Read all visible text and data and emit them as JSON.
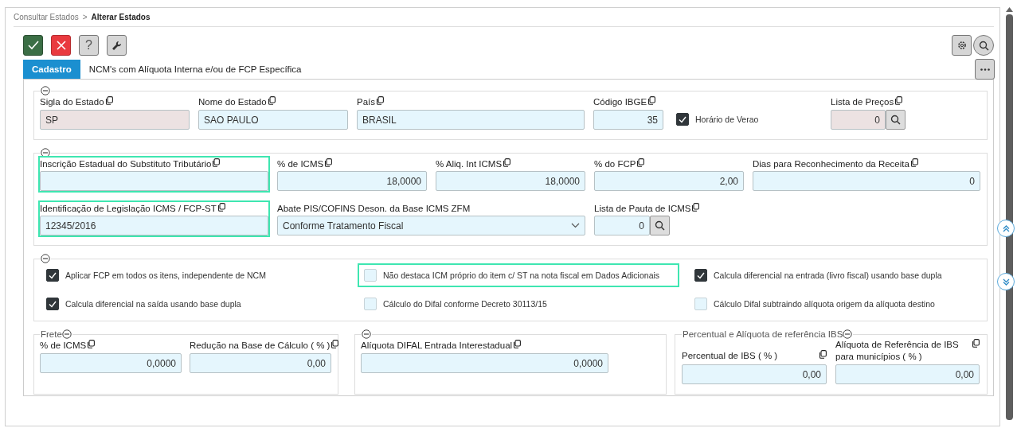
{
  "breadcrumb": [
    {
      "label": "Consultar Estados",
      "current": false
    },
    {
      "label": "Alterar Estados",
      "current": true
    }
  ],
  "breadcrumb_separator": ">",
  "toolbar": [
    {
      "kind": "confirm"
    },
    {
      "kind": "cancel"
    },
    {
      "kind": "help",
      "label": "?"
    },
    {
      "kind": "tools"
    }
  ],
  "right_toolbar": [
    {
      "kind": "settings"
    },
    {
      "kind": "search"
    }
  ],
  "tabs": [
    {
      "label": "Cadastro",
      "selected": true
    },
    {
      "label": "NCM's com Alíquota Interna e/ou de FCP Específica",
      "selected": false
    }
  ],
  "general": {
    "items": [
      {
        "kind": "text",
        "label": "Sigla do Estado",
        "value": "SP",
        "copyable": true,
        "disabled": true,
        "highlighted": false
      },
      {
        "kind": "text",
        "label": "Nome do Estado",
        "value": "SAO PAULO",
        "copyable": true,
        "disabled": false,
        "highlighted": false
      },
      {
        "kind": "text",
        "label": "País",
        "value": "BRASIL",
        "copyable": true,
        "disabled": false,
        "highlighted": false
      },
      {
        "kind": "number",
        "label": "Código IBGE",
        "value": "35",
        "copyable": true,
        "disabled": false,
        "highlighted": false
      },
      {
        "kind": "checkbox",
        "label": "Horário de Verao",
        "checked": true,
        "highlighted": false
      },
      {
        "kind": "lookup",
        "label": "Lista de Preços",
        "value": "0",
        "copyable": true,
        "disabled": true,
        "highlighted": false
      }
    ]
  },
  "tax": {
    "items": [
      {
        "kind": "text",
        "label": "Inscrição Estadual do Substituto Tributário",
        "value": "",
        "copyable": true,
        "disabled": false,
        "highlighted": true
      },
      {
        "kind": "number",
        "label": "% de ICMS",
        "value": "18,0000",
        "copyable": true,
        "disabled": false,
        "highlighted": false
      },
      {
        "kind": "number",
        "label": "% Aliq. Int ICMS",
        "value": "18,0000",
        "copyable": true,
        "disabled": false,
        "highlighted": false
      },
      {
        "kind": "number",
        "label": "% do FCP",
        "value": "2,00",
        "copyable": true,
        "disabled": false,
        "highlighted": false
      },
      {
        "kind": "number",
        "label": "Dias para Reconhecimento da Receita",
        "value": "0",
        "copyable": true,
        "disabled": false,
        "highlighted": false
      },
      {
        "kind": "text",
        "label": "Identificação de Legislação ICMS / FCP-ST",
        "value": "12345/2016",
        "copyable": true,
        "disabled": false,
        "highlighted": true
      },
      {
        "kind": "select",
        "label": "Abate PIS/COFINS Deson. da Base ICMS ZFM",
        "value": "Conforme Tratamento Fiscal",
        "copyable": false,
        "disabled": false,
        "highlighted": false
      },
      {
        "kind": "lookup",
        "label": "Lista de Pauta de ICMS",
        "value": "0",
        "copyable": true,
        "disabled": false,
        "highlighted": false
      }
    ]
  },
  "options": {
    "items": [
      {
        "kind": "checkbox",
        "label": "Aplicar FCP em todos os itens, independente de NCM",
        "checked": true,
        "highlighted": false
      },
      {
        "kind": "checkbox",
        "label": "Não destaca ICM próprio do item c/ ST na nota fiscal em Dados Adicionais",
        "checked": false,
        "highlighted": true
      },
      {
        "kind": "checkbox",
        "label": "Calcula diferencial na entrada (livro fiscal) usando base dupla",
        "checked": true,
        "highlighted": false
      },
      {
        "kind": "checkbox",
        "label": "Calcula diferencial na saída usando base dupla",
        "checked": true,
        "highlighted": false
      },
      {
        "kind": "checkbox",
        "label": "Cálculo do Difal conforme Decreto 30113/15",
        "checked": false,
        "highlighted": false
      },
      {
        "kind": "checkbox",
        "label": "Cálculo Difal subtraindo alíquota origem da alíquota destino",
        "checked": false,
        "highlighted": false
      }
    ]
  },
  "freight": {
    "title": "Frete",
    "items": [
      {
        "kind": "number",
        "label": "% de ICMS",
        "value": "0,0000",
        "copyable": true,
        "disabled": false,
        "highlighted": false
      },
      {
        "kind": "number",
        "label": "Redução na Base de Cálculo ( % )",
        "value": "0,00",
        "copyable": true,
        "disabled": false,
        "highlighted": false
      }
    ]
  },
  "difal": {
    "items": [
      {
        "kind": "number",
        "label": "Alíquota DIFAL Entrada Interestadual",
        "value": "0,0000",
        "copyable": true,
        "disabled": false,
        "highlighted": false
      }
    ]
  },
  "ibs": {
    "title": "Percentual e Alíquota de referência IBS",
    "items": [
      {
        "kind": "number",
        "label": "Percentual de IBS ( % )",
        "value": "0,00",
        "copyable": true,
        "disabled": false,
        "highlighted": false
      },
      {
        "kind": "number",
        "label": "Alíquota de Referência de IBS para municípios ( % )",
        "value": "0,00",
        "copyable": true,
        "disabled": false,
        "highlighted": false
      }
    ]
  }
}
